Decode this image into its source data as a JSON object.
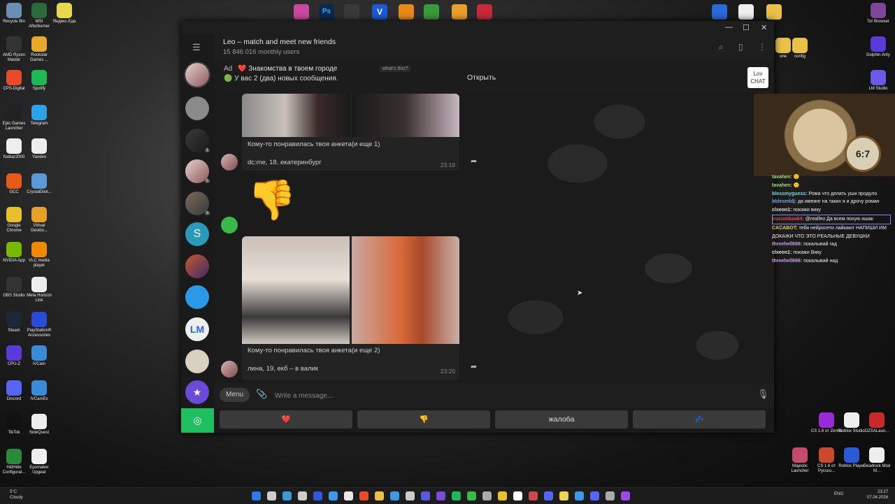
{
  "desktop": {
    "left_icons": [
      {
        "label": "Recycle Bin",
        "color": "#6a8fb5"
      },
      {
        "label": "MSI Afterburner",
        "color": "#2b6a3a"
      },
      {
        "label": "Яндекс.Еда",
        "color": "#e8d84a"
      },
      {
        "label": "AMD Ryzen Master",
        "color": "#333"
      },
      {
        "label": "Rockstar Games ...",
        "color": "#e8a92a"
      },
      {
        "label": "CPS-Digital",
        "color": "#e84a2a"
      },
      {
        "label": "Spotify",
        "color": "#1db954"
      },
      {
        "label": "Epic Games Launcher",
        "color": "#222"
      },
      {
        "label": "Telegram",
        "color": "#2aa3e8"
      },
      {
        "label": "foobar2000",
        "color": "#eee"
      },
      {
        "label": "Yandex",
        "color": "#eee"
      },
      {
        "label": "GCC",
        "color": "#e85a1a"
      },
      {
        "label": "CrystalDisk...",
        "color": "#5a9ad8"
      },
      {
        "label": "Google Chrome",
        "color": "#e8c02a"
      },
      {
        "label": "Virtual Deskto...",
        "color": "#e8a02a"
      },
      {
        "label": "NVIDIA App",
        "color": "#76b900"
      },
      {
        "label": "VLC media player",
        "color": "#f08a00"
      },
      {
        "label": "OBS Studio",
        "color": "#333"
      },
      {
        "label": "Meta Horizon Link",
        "color": "#eee"
      },
      {
        "label": "Steam",
        "color": "#1b2838"
      },
      {
        "label": "PlayStation® Accessories",
        "color": "#2a4ad8"
      },
      {
        "label": "CPU-Z",
        "color": "#5a3ad8"
      },
      {
        "label": "iVCam",
        "color": "#3a8ad8"
      },
      {
        "label": "Discord",
        "color": "#5865f2"
      },
      {
        "label": "iVCamEx",
        "color": "#3a8ad8"
      },
      {
        "label": "TikTok",
        "color": "#111"
      },
      {
        "label": "SideQuest",
        "color": "#eee"
      },
      {
        "label": "HidHide Configurat...",
        "color": "#2a8a3a"
      },
      {
        "label": "Epomaker Upgear",
        "color": "#eee"
      }
    ],
    "right_icons": [
      {
        "label": "Tor Browser",
        "color": "#7d4698"
      },
      {
        "label": "Dolphin Anty",
        "color": "#5a3ad8"
      },
      {
        "label": "LM Studio",
        "color": "#6a5ae8"
      },
      {
        "label": "config",
        "color": "#e8c04a"
      },
      {
        "label": "one",
        "color": "#e8c04a"
      },
      {
        "label": "CS 1.6 от Zenhs",
        "color": "#9a2ad8"
      },
      {
        "label": "Roblox Studio",
        "color": "#eee"
      },
      {
        "label": "DZSALaun...",
        "color": "#c82a2a"
      },
      {
        "label": "Majestic Launcher",
        "color": "#c84a6a"
      },
      {
        "label": "CS 1.6 от Русско...",
        "color": "#c84a2a"
      },
      {
        "label": "Roblox Player",
        "color": "#2a5ad8"
      },
      {
        "label": "Deadlock Mod M...",
        "color": "#eee"
      }
    ]
  },
  "window": {
    "controls": {
      "minimize": "—",
      "maximize": "☐",
      "close": "✕"
    }
  },
  "chat": {
    "title": "Leo – match and meet new friends",
    "subtitle": "15 846 016 monthly users"
  },
  "ad": {
    "label": "Ad",
    "title": "❤️ Знакомства в твоем городе",
    "whats_this": "what's this?",
    "text": "🟢 У вас 2 (два) новых сообщения.",
    "open_label": "Открыть",
    "logo_text": "Lov CHAT"
  },
  "messages": [
    {
      "caption": "Кому-то понравилась твоя анкета(и еще 1)",
      "text": "dc:me, 18, екатеринбург",
      "time": "23:19"
    },
    {
      "sticker": "👎"
    },
    {
      "caption": "Кому-то понравилась твоя анкета(и еще 2)",
      "text": "лина, 19, екб – в валик",
      "time": "23:20"
    }
  ],
  "composer": {
    "menu_label": "Menu",
    "placeholder": "Write a message..."
  },
  "keyboard": [
    {
      "label": "❤️",
      "color": "#e0344a"
    },
    {
      "label": "👎",
      "color": "#e8b23a"
    },
    {
      "label": "жалоба",
      "color": "#dddddd"
    },
    {
      "label": "💤",
      "color": "#4a7ad8"
    }
  ],
  "stream_chat": [
    {
      "user": "tavahen:",
      "text": "🙂",
      "color": "#9be07a"
    },
    {
      "user": "tavahen:",
      "text": "🙂",
      "color": "#9be07a"
    },
    {
      "user": "blessmyguess:",
      "text": "Рома что делать уши продуло",
      "color": "#7ad8e0"
    },
    {
      "user": "bbleseddj:",
      "text": "да имеинг на таких я и дрочу роман",
      "color": "#7aa0e0"
    },
    {
      "user": "clxeon1:",
      "text": "покажи вику",
      "color": "#e0e0e0"
    },
    {
      "user": "cucumbaa64:",
      "text": "@realfeo Да всем похую ишак",
      "color": "#e04a4a",
      "highlight": true
    },
    {
      "user": "CACABOT:",
      "text": "тебя нейросети лайкают НАПИШИ ИМ ДОКАЖИ ЧТО ЭТО РЕАЛЬНЫЕ ДЕВУШКИ",
      "color": "#e0d04a"
    },
    {
      "user": "threehell666:",
      "text": "покалывай гад",
      "color": "#c8a0e0"
    },
    {
      "user": "clxeon1:",
      "text": "покажи Вику",
      "color": "#e0e0e0"
    },
    {
      "user": "threehell666:",
      "text": "покалывай над",
      "color": "#c8a0e0"
    }
  ],
  "overlay": {
    "clock_text": "6:7"
  },
  "taskbar": {
    "weather_temp": "5°C",
    "weather_desc": "Cloudy",
    "lang": "ENG",
    "time": "23:27",
    "date": "07.04.2026"
  }
}
